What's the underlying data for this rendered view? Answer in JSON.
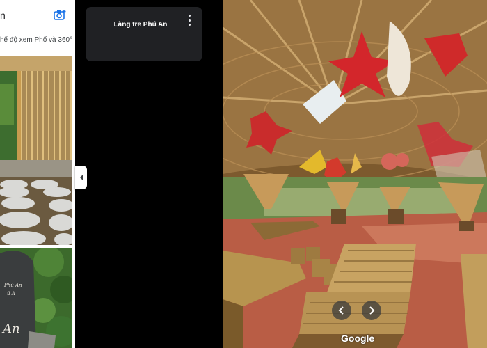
{
  "side_panel": {
    "title": "n",
    "mode_text": "hế độ xem Phố và 360°",
    "stone": {
      "line1": "Phú An",
      "line2": "ú A",
      "line3": "An"
    }
  },
  "title_card": {
    "title": "Làng tre Phú An"
  },
  "attribution": "Google",
  "icons": {
    "camera": "add-photo-camera-icon",
    "kebab": "more-vert-icon",
    "collapse": "chevron-left-icon",
    "prev": "chevron-left-icon",
    "next": "chevron-right-icon"
  }
}
